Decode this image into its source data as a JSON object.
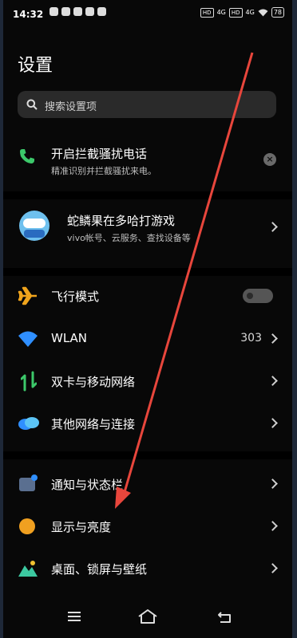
{
  "status_bar": {
    "time": "14:32",
    "network_badges": [
      "HD",
      "4G",
      "HD",
      "4G"
    ],
    "battery": "78"
  },
  "page": {
    "title": "设置"
  },
  "search": {
    "placeholder": "搜索设置项"
  },
  "promo": {
    "title": "开启拦截骚扰电话",
    "subtitle": "精准识别并拦截骚扰来电。"
  },
  "account": {
    "name": "蛇鳞果在多哈打游戏",
    "subtitle": "vivo帐号、云服务、查找设备等"
  },
  "settings": {
    "airplane": {
      "label": "飞行模式",
      "enabled": false
    },
    "wlan": {
      "label": "WLAN",
      "value": "303"
    },
    "sim": {
      "label": "双卡与移动网络"
    },
    "other_network": {
      "label": "其他网络与连接"
    },
    "notifications": {
      "label": "通知与状态栏"
    },
    "display": {
      "label": "显示与亮度"
    },
    "wallpaper": {
      "label": "桌面、锁屏与壁纸"
    }
  },
  "colors": {
    "annotation_arrow": "#e8463c",
    "phone_icon": "#3cc86a",
    "airplane_icon": "#f0a41c",
    "wifi_icon": "#2f8fff",
    "display_icon": "#f0a020"
  }
}
